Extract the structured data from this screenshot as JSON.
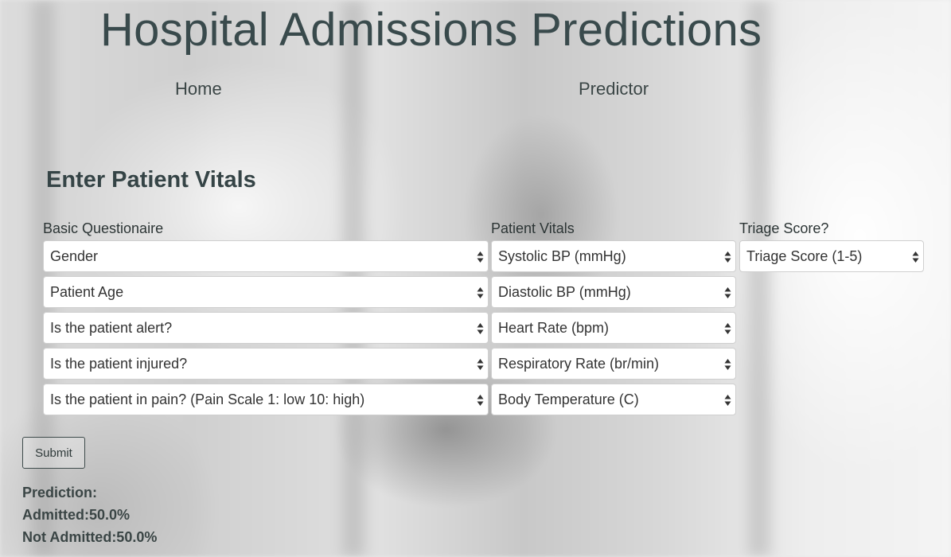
{
  "header": {
    "title": "Hospital Admissions Predictions",
    "nav": [
      {
        "label": "Home"
      },
      {
        "label": "Predictor"
      }
    ]
  },
  "form": {
    "heading": "Enter Patient Vitals",
    "columns": {
      "basic": {
        "label": "Basic Questionaire",
        "selects": [
          {
            "value": "Gender"
          },
          {
            "value": "Patient Age"
          },
          {
            "value": "Is the patient alert?"
          },
          {
            "value": "Is the patient injured?"
          },
          {
            "value": "Is the patient in pain? (Pain Scale 1: low 10: high)"
          }
        ]
      },
      "vitals": {
        "label": "Patient Vitals",
        "selects": [
          {
            "value": "Systolic BP (mmHg)"
          },
          {
            "value": "Diastolic BP (mmHg)"
          },
          {
            "value": "Heart Rate (bpm)"
          },
          {
            "value": "Respiratory Rate (br/min)"
          },
          {
            "value": "Body Temperature (C)"
          }
        ]
      },
      "triage": {
        "label": "Triage Score?",
        "selects": [
          {
            "value": "Triage Score (1-5)"
          }
        ]
      }
    },
    "submit_label": "Submit"
  },
  "prediction": {
    "heading": "Prediction:",
    "admitted": "Admitted:50.0%",
    "not_admitted": "Not Admitted:50.0%"
  },
  "icons": {
    "select_arrow": "sort-arrows-icon"
  }
}
